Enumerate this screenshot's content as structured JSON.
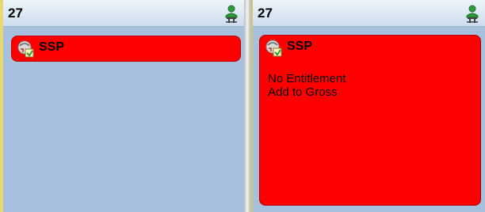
{
  "panels": [
    {
      "day": "27",
      "card": {
        "title": "SSP",
        "lines": []
      }
    },
    {
      "day": "27",
      "card": {
        "title": "SSP",
        "lines": [
          "No Entitlement",
          "Add to Gross"
        ]
      }
    }
  ],
  "icons": {
    "person": "person-icon",
    "card": "absence-icon"
  },
  "colors": {
    "card_bg": "#ff0000",
    "panel_bg": "#a7c0de",
    "header_bg": "#dce8f5"
  }
}
